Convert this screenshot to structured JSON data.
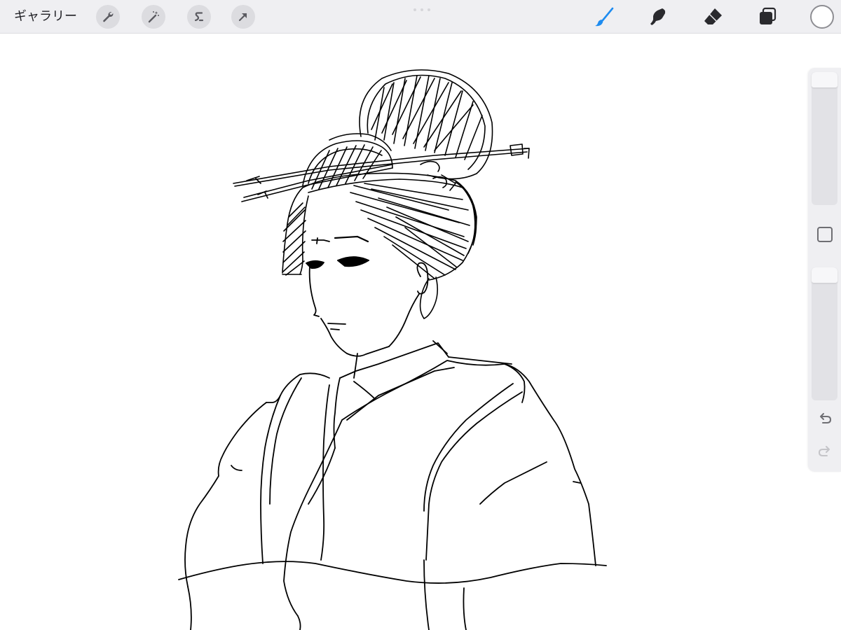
{
  "toolbar": {
    "gallery_label": "ギャラリー",
    "left_tools": [
      {
        "name": "actions",
        "icon": "wrench-icon"
      },
      {
        "name": "adjustments",
        "icon": "magic-wand-icon"
      },
      {
        "name": "selection",
        "icon": "selection-s-icon"
      },
      {
        "name": "transform",
        "icon": "arrow-cursor-icon"
      }
    ],
    "right_tools": [
      {
        "name": "paint",
        "icon": "brush-icon",
        "active": true,
        "color": "#1e8cf0"
      },
      {
        "name": "smudge",
        "icon": "smudge-icon",
        "active": false
      },
      {
        "name": "erase",
        "icon": "eraser-icon",
        "active": false
      },
      {
        "name": "layers",
        "icon": "layers-icon",
        "active": false
      }
    ],
    "current_color": "#ffffff"
  },
  "sidebar": {
    "brush_size_slider": {
      "value": 1.0
    },
    "modify_button": "square-icon",
    "opacity_slider": {
      "value": 1.0
    },
    "undo_icon": "undo-icon",
    "redo_icon": "redo-icon",
    "redo_enabled": false
  },
  "canvas": {
    "subject": "line-art-sketch",
    "background": "#ffffff",
    "stroke_color": "#000000"
  }
}
